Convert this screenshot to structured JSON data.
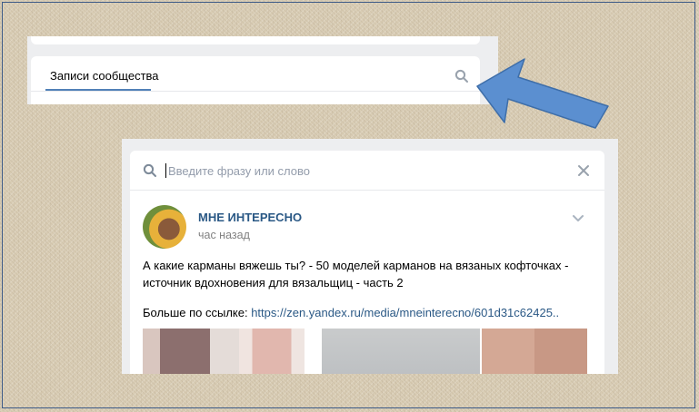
{
  "community_tab": {
    "label": "Записи сообщества",
    "icon": "search-icon"
  },
  "search": {
    "placeholder": "Введите фразу или слово",
    "value": ""
  },
  "post": {
    "author": "МНЕ ИНТЕРЕСНО",
    "time": "час назад",
    "text": "А какие карманы вяжешь ты? - 50 моделей карманов на вязаных кофточках - источник вдохновения для вязальщиц - часть 2",
    "more_prefix": "Больше по ссылке: ",
    "link": "https://zen.yandex.ru/media/mneinterecno/601d31c62425..",
    "photos_count": 4
  },
  "colors": {
    "link": "#2a5885",
    "accent": "#5181b8",
    "arrow": "#5b8fd0",
    "muted": "#939cab"
  }
}
